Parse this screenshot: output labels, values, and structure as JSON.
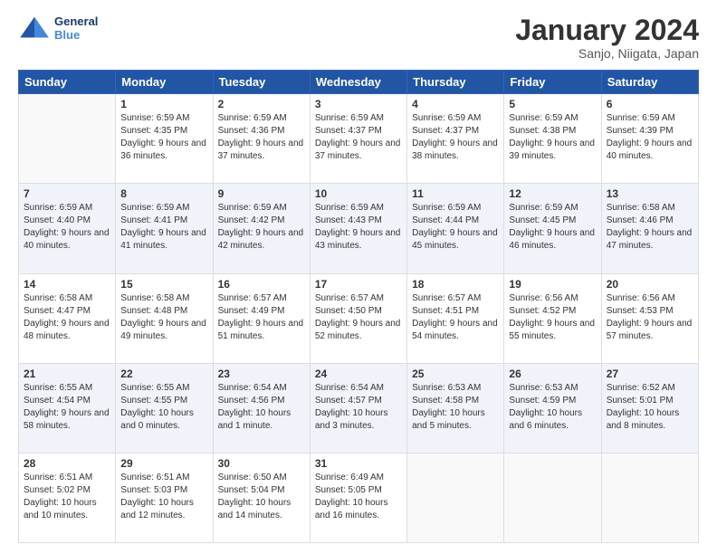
{
  "logo": {
    "line1": "General",
    "line2": "Blue"
  },
  "title": "January 2024",
  "subtitle": "Sanjo, Niigata, Japan",
  "days": [
    "Sunday",
    "Monday",
    "Tuesday",
    "Wednesday",
    "Thursday",
    "Friday",
    "Saturday"
  ],
  "weeks": [
    [
      {
        "date": "",
        "empty": true
      },
      {
        "date": "1",
        "sunrise": "Sunrise: 6:59 AM",
        "sunset": "Sunset: 4:35 PM",
        "daylight": "Daylight: 9 hours and 36 minutes."
      },
      {
        "date": "2",
        "sunrise": "Sunrise: 6:59 AM",
        "sunset": "Sunset: 4:36 PM",
        "daylight": "Daylight: 9 hours and 37 minutes."
      },
      {
        "date": "3",
        "sunrise": "Sunrise: 6:59 AM",
        "sunset": "Sunset: 4:37 PM",
        "daylight": "Daylight: 9 hours and 37 minutes."
      },
      {
        "date": "4",
        "sunrise": "Sunrise: 6:59 AM",
        "sunset": "Sunset: 4:37 PM",
        "daylight": "Daylight: 9 hours and 38 minutes."
      },
      {
        "date": "5",
        "sunrise": "Sunrise: 6:59 AM",
        "sunset": "Sunset: 4:38 PM",
        "daylight": "Daylight: 9 hours and 39 minutes."
      },
      {
        "date": "6",
        "sunrise": "Sunrise: 6:59 AM",
        "sunset": "Sunset: 4:39 PM",
        "daylight": "Daylight: 9 hours and 40 minutes."
      }
    ],
    [
      {
        "date": "7",
        "sunrise": "Sunrise: 6:59 AM",
        "sunset": "Sunset: 4:40 PM",
        "daylight": "Daylight: 9 hours and 40 minutes."
      },
      {
        "date": "8",
        "sunrise": "Sunrise: 6:59 AM",
        "sunset": "Sunset: 4:41 PM",
        "daylight": "Daylight: 9 hours and 41 minutes."
      },
      {
        "date": "9",
        "sunrise": "Sunrise: 6:59 AM",
        "sunset": "Sunset: 4:42 PM",
        "daylight": "Daylight: 9 hours and 42 minutes."
      },
      {
        "date": "10",
        "sunrise": "Sunrise: 6:59 AM",
        "sunset": "Sunset: 4:43 PM",
        "daylight": "Daylight: 9 hours and 43 minutes."
      },
      {
        "date": "11",
        "sunrise": "Sunrise: 6:59 AM",
        "sunset": "Sunset: 4:44 PM",
        "daylight": "Daylight: 9 hours and 45 minutes."
      },
      {
        "date": "12",
        "sunrise": "Sunrise: 6:59 AM",
        "sunset": "Sunset: 4:45 PM",
        "daylight": "Daylight: 9 hours and 46 minutes."
      },
      {
        "date": "13",
        "sunrise": "Sunrise: 6:58 AM",
        "sunset": "Sunset: 4:46 PM",
        "daylight": "Daylight: 9 hours and 47 minutes."
      }
    ],
    [
      {
        "date": "14",
        "sunrise": "Sunrise: 6:58 AM",
        "sunset": "Sunset: 4:47 PM",
        "daylight": "Daylight: 9 hours and 48 minutes."
      },
      {
        "date": "15",
        "sunrise": "Sunrise: 6:58 AM",
        "sunset": "Sunset: 4:48 PM",
        "daylight": "Daylight: 9 hours and 49 minutes."
      },
      {
        "date": "16",
        "sunrise": "Sunrise: 6:57 AM",
        "sunset": "Sunset: 4:49 PM",
        "daylight": "Daylight: 9 hours and 51 minutes."
      },
      {
        "date": "17",
        "sunrise": "Sunrise: 6:57 AM",
        "sunset": "Sunset: 4:50 PM",
        "daylight": "Daylight: 9 hours and 52 minutes."
      },
      {
        "date": "18",
        "sunrise": "Sunrise: 6:57 AM",
        "sunset": "Sunset: 4:51 PM",
        "daylight": "Daylight: 9 hours and 54 minutes."
      },
      {
        "date": "19",
        "sunrise": "Sunrise: 6:56 AM",
        "sunset": "Sunset: 4:52 PM",
        "daylight": "Daylight: 9 hours and 55 minutes."
      },
      {
        "date": "20",
        "sunrise": "Sunrise: 6:56 AM",
        "sunset": "Sunset: 4:53 PM",
        "daylight": "Daylight: 9 hours and 57 minutes."
      }
    ],
    [
      {
        "date": "21",
        "sunrise": "Sunrise: 6:55 AM",
        "sunset": "Sunset: 4:54 PM",
        "daylight": "Daylight: 9 hours and 58 minutes."
      },
      {
        "date": "22",
        "sunrise": "Sunrise: 6:55 AM",
        "sunset": "Sunset: 4:55 PM",
        "daylight": "Daylight: 10 hours and 0 minutes."
      },
      {
        "date": "23",
        "sunrise": "Sunrise: 6:54 AM",
        "sunset": "Sunset: 4:56 PM",
        "daylight": "Daylight: 10 hours and 1 minute."
      },
      {
        "date": "24",
        "sunrise": "Sunrise: 6:54 AM",
        "sunset": "Sunset: 4:57 PM",
        "daylight": "Daylight: 10 hours and 3 minutes."
      },
      {
        "date": "25",
        "sunrise": "Sunrise: 6:53 AM",
        "sunset": "Sunset: 4:58 PM",
        "daylight": "Daylight: 10 hours and 5 minutes."
      },
      {
        "date": "26",
        "sunrise": "Sunrise: 6:53 AM",
        "sunset": "Sunset: 4:59 PM",
        "daylight": "Daylight: 10 hours and 6 minutes."
      },
      {
        "date": "27",
        "sunrise": "Sunrise: 6:52 AM",
        "sunset": "Sunset: 5:01 PM",
        "daylight": "Daylight: 10 hours and 8 minutes."
      }
    ],
    [
      {
        "date": "28",
        "sunrise": "Sunrise: 6:51 AM",
        "sunset": "Sunset: 5:02 PM",
        "daylight": "Daylight: 10 hours and 10 minutes."
      },
      {
        "date": "29",
        "sunrise": "Sunrise: 6:51 AM",
        "sunset": "Sunset: 5:03 PM",
        "daylight": "Daylight: 10 hours and 12 minutes."
      },
      {
        "date": "30",
        "sunrise": "Sunrise: 6:50 AM",
        "sunset": "Sunset: 5:04 PM",
        "daylight": "Daylight: 10 hours and 14 minutes."
      },
      {
        "date": "31",
        "sunrise": "Sunrise: 6:49 AM",
        "sunset": "Sunset: 5:05 PM",
        "daylight": "Daylight: 10 hours and 16 minutes."
      },
      {
        "date": "",
        "empty": true
      },
      {
        "date": "",
        "empty": true
      },
      {
        "date": "",
        "empty": true
      }
    ]
  ]
}
